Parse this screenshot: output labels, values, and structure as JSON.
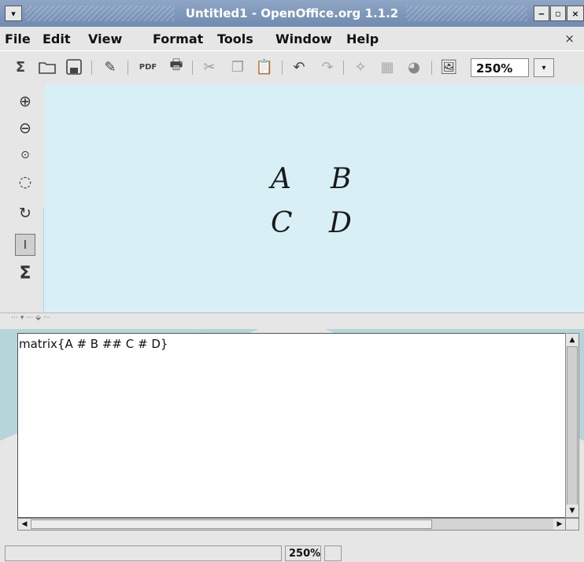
{
  "window": {
    "title": "Untitled1 - OpenOffice.org 1.1.2"
  },
  "menu": {
    "items": [
      {
        "label": "File"
      },
      {
        "label": "Edit"
      },
      {
        "label": "View"
      },
      {
        "label": "Format"
      },
      {
        "label": "Tools"
      },
      {
        "label": "Window"
      },
      {
        "label": "Help"
      }
    ],
    "close_glyph": "×"
  },
  "toolbar": {
    "zoom_value": "250%"
  },
  "icons": {
    "toolbar": [
      "sigma-icon",
      "open-folder-icon",
      "save-icon",
      "edit-icon",
      "export-pdf-icon",
      "print-icon",
      "cut-icon",
      "copy-icon",
      "paste-icon",
      "undo-icon",
      "redo-icon",
      "navigator-icon",
      "gallery-icon",
      "sphere-icon",
      "image-icon"
    ],
    "left_tools": [
      "zoom-in-icon",
      "zoom-out-icon",
      "zoom-100-icon",
      "show-all-icon",
      "refresh-icon",
      "formula-cursor-icon",
      "symbols-icon"
    ]
  },
  "preview": {
    "cells": [
      "A",
      "B",
      "C",
      "D"
    ]
  },
  "editor": {
    "formula": "matrix{A # B ## C # D}"
  },
  "status": {
    "zoom": "250%"
  },
  "colors": {
    "titlebar": "#7d96b8",
    "preview_bg": "#d8eff5",
    "watermark": "#4bb6c3"
  }
}
